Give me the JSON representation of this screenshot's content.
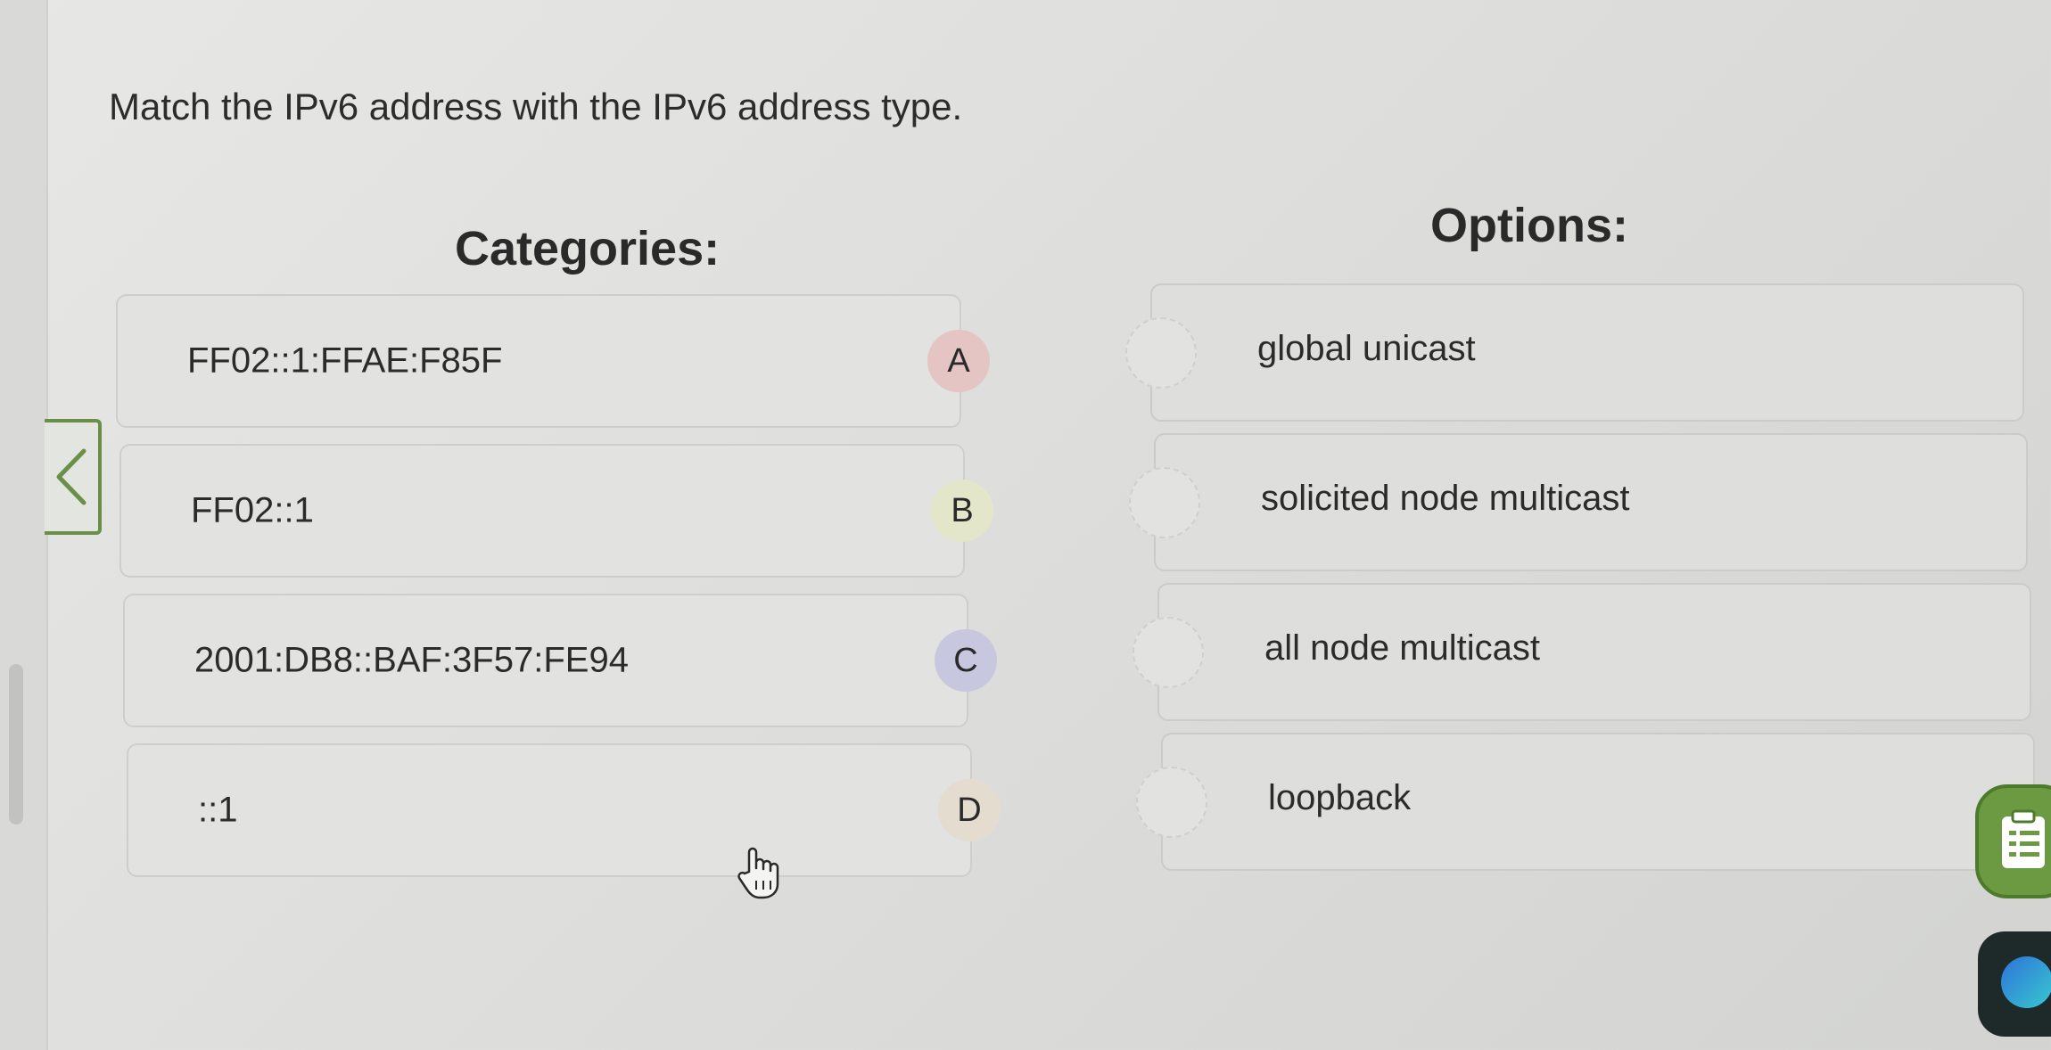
{
  "question": {
    "prompt": "Match the IPv6 address with the IPv6 address type."
  },
  "categories": {
    "heading": "Categories:",
    "items": [
      {
        "address": "FF02::1:FFAE:F85F",
        "letter": "A"
      },
      {
        "address": "FF02::1",
        "letter": "B"
      },
      {
        "address": "2001:DB8::BAF:3F57:FE94",
        "letter": "C"
      },
      {
        "address": "::1",
        "letter": "D"
      }
    ]
  },
  "options": {
    "heading": "Options:",
    "items": [
      {
        "label": "global unicast"
      },
      {
        "label": "solicited node multicast"
      },
      {
        "label": "all node multicast"
      },
      {
        "label": "loopback"
      }
    ]
  },
  "icons": {
    "back": "chevron-left-icon",
    "cursor": "hand-pointer-icon",
    "notes": "clipboard-icon",
    "app": "app-logo-icon"
  },
  "colors": {
    "accent_green": "#6b9a42",
    "badge_a": "#e4c5c3",
    "badge_b": "#e3e6c9",
    "badge_c": "#c8c7e0",
    "badge_d": "#e4dccf"
  }
}
